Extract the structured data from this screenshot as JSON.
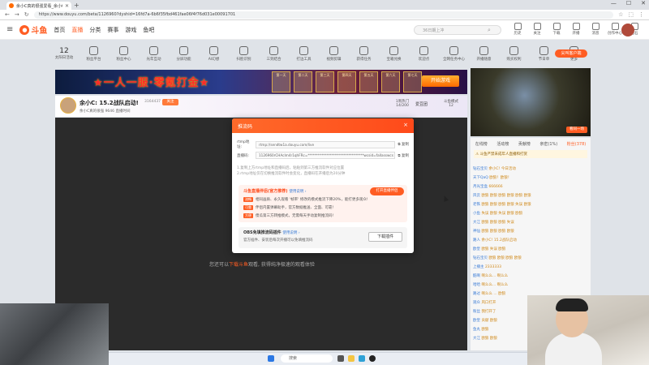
{
  "browser": {
    "tab_title": "余小C真的很强爱看_余小C真的很...",
    "new_tab": "+",
    "url": "https://www.douyu.com/beta/1126960?dyshid=16fd7a-6b6f35fbd461fae06f4f76d031e00091701",
    "window_controls": [
      "—",
      "☐",
      "✕"
    ],
    "nav": [
      "←",
      "→",
      "↻"
    ]
  },
  "header": {
    "logo_text": "斗鱼",
    "nav": [
      "首页",
      "直播",
      "分类",
      "赛事",
      "游戏",
      "鱼吧"
    ],
    "search_placeholder": "36日期上冲",
    "user_icons": [
      "历史",
      "关注",
      "下载",
      "开播",
      "消息",
      "创作中心",
      "钻石"
    ]
  },
  "category_strip": {
    "level_number": "12",
    "level_label": "太阳日活动",
    "items": [
      "粉丝平台",
      "粉丝中心",
      "光年互动",
      "分屏功能",
      "AI幻想",
      "扫脸识别",
      "三到结合",
      "打边工具",
      "视频剪辑",
      "获得任务",
      "宝箱兑换",
      "欢迎点",
      "全网任务中心",
      "开播随意",
      "购买权利",
      "节日单",
      "更多"
    ],
    "fire_button": "尖叫客户端"
  },
  "banner": {
    "title": "★一人一服·零氪打金★",
    "prizes": [
      "第一天",
      "第二天",
      "第三天",
      "第四天",
      "第五天",
      "第六天",
      "第七天"
    ],
    "cta": "开始游戏"
  },
  "streamer": {
    "title": "余小C: 15.2战队启动!",
    "sub": "余小C真的很强  9646  直播时间",
    "count": "3164437",
    "follow": "关注",
    "rank": "1周热门 14/200",
    "button1": "爱豆团",
    "button2": "斗鱼模式 12"
  },
  "video": {
    "message_pre": "您还可以",
    "message_highlight": "下载斗鱼",
    "message_post": "观看, 获得纯净极速的观看体验"
  },
  "right_panel": {
    "mini_button": "看同一场",
    "tabs": [
      "在线榜",
      "活动榜",
      "贡献榜",
      "亲密(1%)",
      "粉丝(378)"
    ],
    "notice": "⚠ 斗鱼严禁未成年人直播和打赏",
    "chat_lines": [
      {
        "user": "钻石宝贝",
        "text": "余小C! 今日活动"
      },
      {
        "user": "天下QaQ",
        "text": "欧狼！欧狼！"
      },
      {
        "user": "月光宝盒",
        "text": "666666"
      },
      {
        "user": "风云",
        "text": "欧狼 欧狼 欧狼 欧狼 欧狼 欧狼"
      },
      {
        "user": "老铁",
        "text": "欧狼 欧狼 欧狼 欧狼 失误 欧狼"
      },
      {
        "user": "小鱼",
        "text": "失误 欧狼 失误 欧狼 欧狼"
      },
      {
        "user": "大江",
        "text": "欧狼 欧狼 欧狼 失误"
      },
      {
        "user": "神仙",
        "text": "欧狼 欧狼 欧狼 欧狼"
      },
      {
        "user": "路人",
        "text": "余小C! 15.2战队启动"
      },
      {
        "user": "欧皇",
        "text": "欧狼 失误 欧狼"
      },
      {
        "user": "钻石宝贝",
        "text": "欧狼 欧狼 欧狼 欧狼"
      },
      {
        "user": "上播主",
        "text": "2333333"
      },
      {
        "user": "酷啊",
        "text": "啊么么... 啊么么"
      },
      {
        "user": "哈哈",
        "text": "啊么么... 啊么么"
      },
      {
        "user": "路过",
        "text": "啊么么 ... 欧狼"
      },
      {
        "user": "观众",
        "text": "风口打开"
      },
      {
        "user": "粉丝",
        "text": "我打开了"
      },
      {
        "user": "欧皇",
        "text": "贡献 欧狼"
      },
      {
        "user": "鱼丸",
        "text": "欧狼"
      },
      {
        "user": "大江",
        "text": "欧狼 欧狼"
      }
    ]
  },
  "dialog": {
    "title": "推流码",
    "close": "×",
    "rtmp_label": "rtmp地址:",
    "rtmp_value": "rtmp://sendtw1a.douyu.com/live",
    "key_label": "直播码:",
    "key_value": "1126960rCHAcIm4r1qhFRc=*********************************wcsid=fallasswcs",
    "copy": "复制",
    "notes": [
      "1.复制上方rtmp地址和直播码后，粘贴到第三方推流软件对应位置",
      "2.rtmp地址仅在切换推流软件时会变化，直播码在开播后为20分钟"
    ],
    "tool_title": "斗鱼直播伴侣(官方推荐)",
    "tool_tutorial": "使用说明 ›",
    "tool_open": "打开直播伴侣",
    "features": [
      {
        "tag": "流畅",
        "text": "相同画质、永久观看 '帧率' 修改的模式推流下降20%，能打更多观众!"
      },
      {
        "tag": "可靠",
        "text": "伴侣内置弹幕助手，官方数据推送、全面、可靠!"
      },
      {
        "tag": "方便",
        "text": "傻瓜第三方转推模式，无需每天手动复制推流码!"
      }
    ],
    "obs_title": "OBS免填推流码插件",
    "obs_tutorial": "使用说明 ›",
    "obs_desc": "官方插件、安装后每次开播可以免填推流码",
    "obs_button": "下载插件"
  },
  "taskbar": {
    "search": "搜索"
  }
}
